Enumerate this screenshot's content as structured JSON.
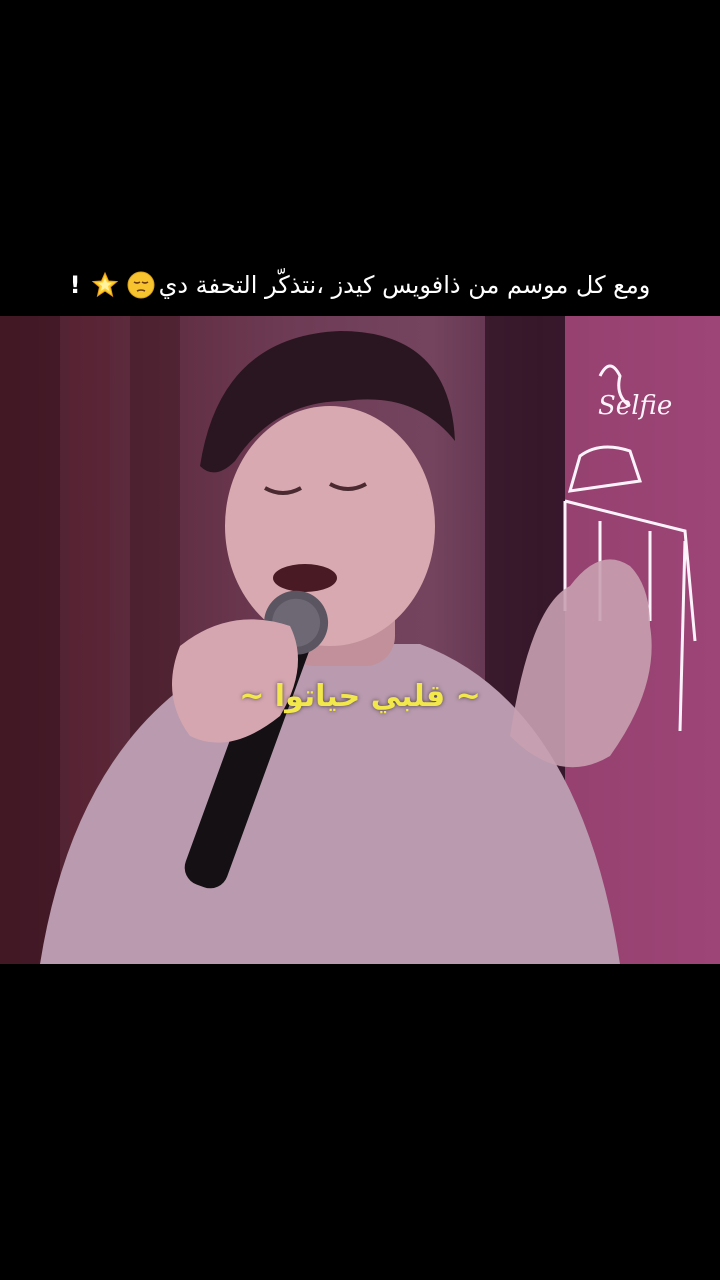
{
  "caption": {
    "text": "ومع كل موسم من ذافويس كيدز ،نتذكّر التحفة دي",
    "suffix": "!",
    "emojis": [
      "pensive-face-emoji",
      "glowing-star-emoji"
    ]
  },
  "overlay": {
    "lyric": "~ قلبي حياتوا ~"
  },
  "scene": {
    "neon_sign_text": "Selfie",
    "colors": {
      "text": "#ffffff",
      "lyric": "#f2e84b",
      "background": "#000000"
    }
  }
}
